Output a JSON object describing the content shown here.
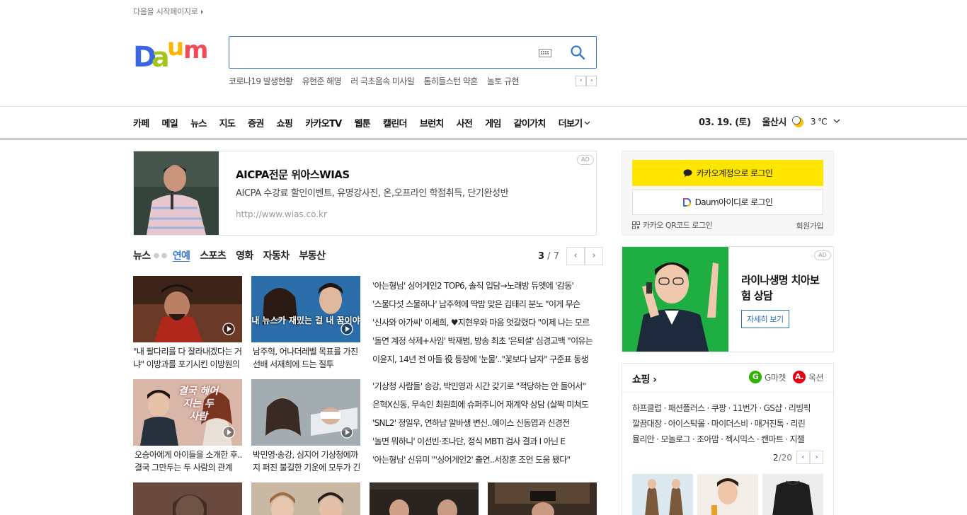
{
  "header": {
    "start_page": "다음을 시작페이지로",
    "logo_alt": "Daum",
    "search": {
      "value": "",
      "placeholder": ""
    },
    "trending": [
      "코로나19 발생현황",
      "유현준 해명",
      "러 극초음속 미사일",
      "톰히들스턴 약혼",
      "놀토 규현"
    ]
  },
  "gnb": {
    "menu": [
      "카페",
      "메일",
      "뉴스",
      "지도",
      "증권",
      "쇼핑",
      "카카오TV",
      "웹툰",
      "캘린더",
      "브런치",
      "사전",
      "게임",
      "같이가치"
    ],
    "more": "더보기",
    "date": "03. 19. (토)",
    "city": "울산시",
    "temperature": "3 ℃"
  },
  "ad_top": {
    "badge": "AD",
    "title": "AICPA전문 위아스WIAS",
    "desc": "AICPA 수강료 할인이벤트, 유명강사진, 온,오프라인 학점취득, 단기완성반",
    "url": "http://www.wias.co.kr"
  },
  "news": {
    "tabs": [
      "뉴스",
      "연예",
      "스포츠",
      "영화",
      "자동차",
      "부동산"
    ],
    "active_tab": "연예",
    "page_current": "3",
    "page_total": " / 7",
    "thumbs": [
      {
        "caption": "\"내 팔다리를 다 잘라내겠다는 거냐\" 이방과를 포기시킨 이방원의 한 마디"
      },
      {
        "caption": "남주혁, 어나더레벨 목표를 가진 선배 서재희에 드는 질투",
        "overlay": "내 뉴스가 재밌는 걸 내 꿈이야"
      },
      {
        "caption": "오승아에게 아이들을 소개한 후.. 결국 그만두는 두 사람의 관계",
        "overlay": "결국 헤어지는 두 사람"
      },
      {
        "caption": "박민영·송강, 심지어 기상청에까지 퍼진 불길한 기운에 모두가 긴장"
      }
    ],
    "list1": [
      "'아는형님' 싱어게인2 TOP6, 솔직 입담→노래방 듀엣에 '감동'",
      "'스물다섯 스물하나' 남주혁에 딱밤 맞은 김태리 분노 \"이게 무슨",
      "'신사와 아가씨' 이세희, ♥지현우와 마음 엇갈렸다 \"이제 나는 모르",
      "'돌연 계정 삭제+사임' 박재범, 방송 최초 '은퇴설' 심경고백 \"이유는",
      "이윤지, 14년 전 아들 役 등장에 '눈물'..\"꽃보다 남자\" 구준표 동생"
    ],
    "list2": [
      "'기상청 사람들' 송강, 박민영과 시간 갖기로 \"적당하는 안 들어서\"",
      "은혁X신동, 무속인 최원희에 슈퍼주니어 재계약 상담 (살짝 미쳐도",
      "'SNL2' 정일우, 연하남 알바생 변신..에이스 신동엽과 신경전",
      "'놀면 뭐하니' 이선빈·조나단, 정식 MBTI 검사 결과 I 아닌 E",
      "'아는형님' 신유미 \"'싱어게인2' 출연..서장훈 조언 도움 됐다\""
    ]
  },
  "login": {
    "kakao": "카카오계정으로 로그인",
    "daum": "Daum아이디로 로그인",
    "qr": "카카오 QR코드 로그인",
    "signup": "회원가입"
  },
  "ad_right": {
    "badge": "AD",
    "title": "라이나생명 치아보험 상담",
    "button": "자세히 보기"
  },
  "shopping": {
    "title": "쇼핑",
    "brands": [
      {
        "icon": "G",
        "label": "G마켓",
        "color": "#2db400"
      },
      {
        "icon": "A.",
        "label": "옥션",
        "color": "#e60012"
      }
    ],
    "links": [
      "하프클럽 · 패션플러스 · 쿠팡 · 11번가 · GS샵 · 리빙픽",
      "깔끔대장 · 아이스탁몰 · 마이더스비 · 매거진톡 · 리린",
      "뮬리안 · 모놀로그 · 조아맘 · 젝시믹스 · 캔마트 · 지젤"
    ],
    "page_current": "2",
    "page_total": "/20"
  },
  "colors": {
    "accent": "#3476d1",
    "kakao": "#fee500",
    "ad_green": "#1fae41"
  }
}
